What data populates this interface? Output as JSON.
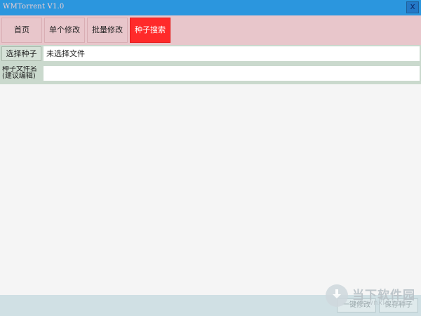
{
  "window": {
    "title": "WMTorrent V1.0",
    "close_label": "X"
  },
  "tabs": [
    {
      "label": "首页",
      "active": false
    },
    {
      "label": "单个修改",
      "active": false
    },
    {
      "label": "批量修改",
      "active": false
    },
    {
      "label": "种子搜索",
      "active": true
    }
  ],
  "form": {
    "select_button": "选择种子",
    "file_status": "未选择文件",
    "name_label": "种子文件名(建议编辑)",
    "name_value": ""
  },
  "footer": {
    "button_1": "一键修改",
    "button_2": "保存种子"
  },
  "watermark": {
    "text": "当下软件园",
    "sub": "downxia.com"
  },
  "colors": {
    "titlebar": "#2b96de",
    "navbar": "#e8c6cb",
    "active_tab": "#ff2a2a",
    "form_row": "#cad9cd",
    "footer": "#d0e0e4"
  }
}
